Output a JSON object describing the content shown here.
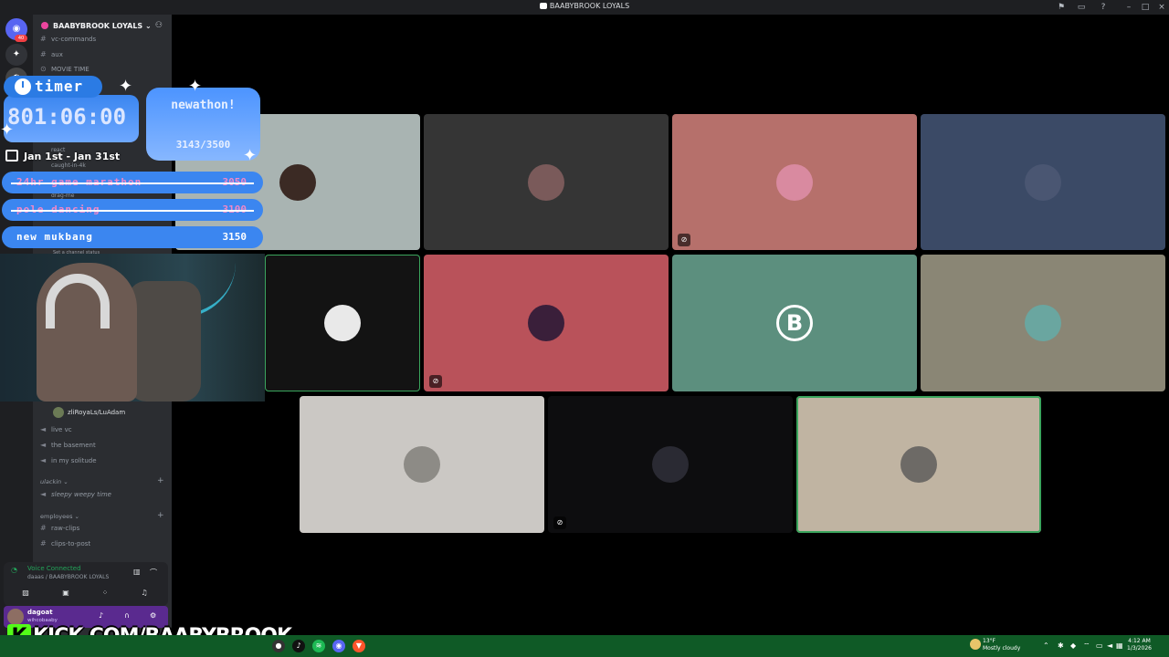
{
  "window": {
    "title": "BAABYBROOK LOYALS"
  },
  "rail": {
    "badge": "40"
  },
  "guild": {
    "name": "BAABYBROOK LOYALS"
  },
  "channels": {
    "top": [
      {
        "label": "vc-commands"
      },
      {
        "label": "aux"
      },
      {
        "label": "MOVIE TIME"
      }
    ],
    "partial": [
      {
        "label": "react"
      },
      {
        "label": "caught-in-4k"
      },
      {
        "label": "drag-me"
      }
    ],
    "set_status": "Set a channel status",
    "voice_user": "zliRoyaLs/LuAdam",
    "voice_channels": [
      {
        "label": "live vc"
      },
      {
        "label": "the basement"
      },
      {
        "label": "in my solitude"
      }
    ],
    "category_1": "ulackin",
    "category_1_channel": "sleepy weepy time",
    "category_2": "employees",
    "category_2_channels": [
      {
        "label": "raw-clips"
      },
      {
        "label": "clips-to-post"
      }
    ]
  },
  "voice_panel": {
    "status": "Voice Connected",
    "location": "daaas / BAABYBROOK LOYALS"
  },
  "user_panel": {
    "name": "dagoat",
    "status": "wihcobaaby"
  },
  "overlay": {
    "timer_label": "timer",
    "timer_value": "801:06:00",
    "subathon_title": "newathon!",
    "subathon_progress": "3143/3500",
    "dates": "Jan 1st - Jan 31st",
    "goals": [
      {
        "name": "24hr game marathon",
        "target": "3050",
        "done": true
      },
      {
        "name": "pole dancing",
        "target": "3100",
        "done": true
      },
      {
        "name": "new mukbang",
        "target": "3150",
        "done": false
      }
    ],
    "kick_url": "KICK.COM/BAABYBROOK"
  },
  "video_tiles": [
    {
      "bg": "#a9b4b2",
      "avatar": "#3b2a24",
      "muted": false
    },
    {
      "bg": "#353535",
      "avatar": "#7a5a5a",
      "muted": false
    },
    {
      "bg": "#b6706b",
      "avatar": "#d98aa0",
      "muted": true
    },
    {
      "bg": "#3b4a66",
      "avatar": "#4a5672",
      "muted": false
    },
    {
      "bg": "#131313",
      "avatar": "#e9e9e9",
      "muted": false
    },
    {
      "bg": "#b9525a",
      "avatar": "#3a1f3a",
      "muted": true
    },
    {
      "bg": "#5c8f7e",
      "avatar": "B",
      "muted": false
    },
    {
      "bg": "#8a8675",
      "avatar": "#6aa6a0",
      "muted": false
    },
    {
      "bg": "#cbc8c4",
      "avatar": "#8d8b86",
      "muted": false
    },
    {
      "bg": "#0d0d0f",
      "avatar": "#2a2a33",
      "muted": true
    },
    {
      "bg": "#c0b4a2",
      "avatar": "#6d6a66",
      "muted": false
    }
  ],
  "taskbar": {
    "temp": "13°F",
    "weather": "Mostly cloudy",
    "time": "4:12 AM",
    "date": "1/3/2026"
  },
  "colors": {
    "accent_green": "#3ba55d",
    "overlay_blue": "#3b86f0",
    "kick_green": "#53fc18"
  }
}
